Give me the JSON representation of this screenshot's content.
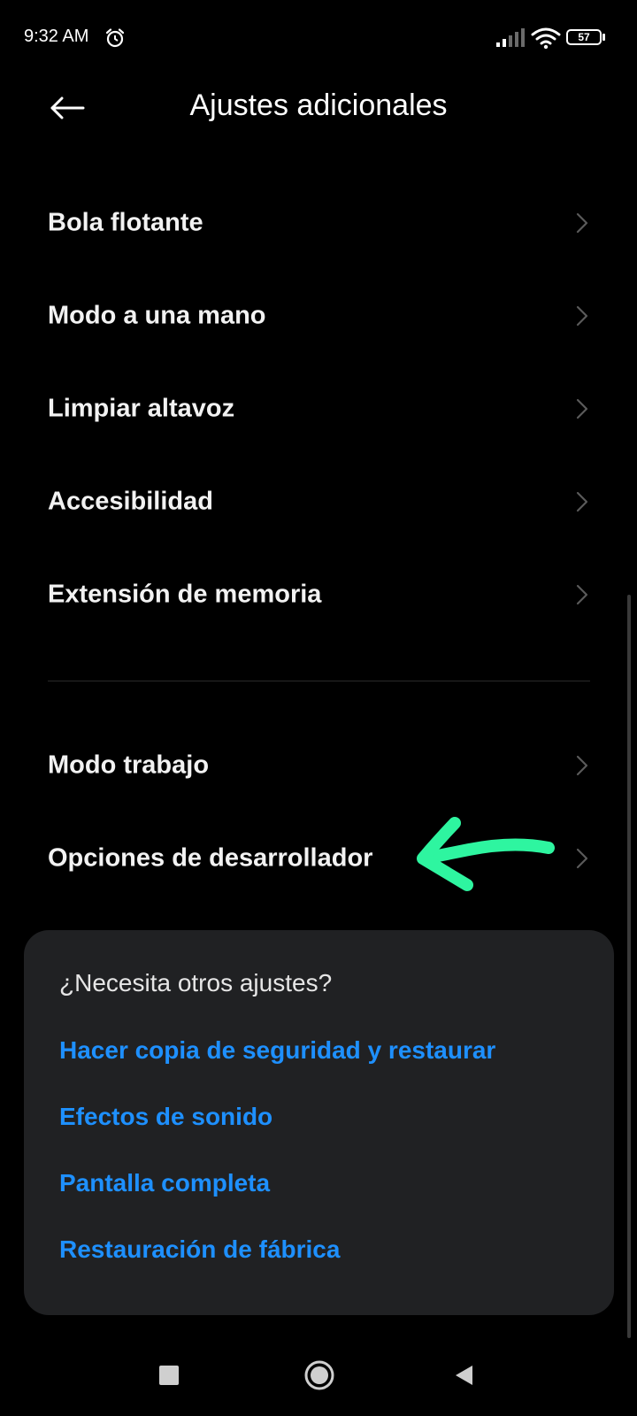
{
  "status_bar": {
    "time": "9:32 AM",
    "battery_level": "57",
    "battery_fraction": 0.57
  },
  "header": {
    "back_icon": "arrow-left-icon",
    "title": "Ajustes adicionales"
  },
  "settings": {
    "group1": [
      {
        "label": "Bola flotante"
      },
      {
        "label": "Modo a una mano"
      },
      {
        "label": "Limpiar altavoz"
      },
      {
        "label": "Accesibilidad"
      },
      {
        "label": "Extensión de memoria"
      }
    ],
    "group2": [
      {
        "label": "Modo trabajo"
      },
      {
        "label": "Opciones de desarrollador"
      }
    ]
  },
  "annotation": {
    "color": "#2ef5a0",
    "icon": "hand-drawn-arrow-icon"
  },
  "suggestions": {
    "title": "¿Necesita otros ajustes?",
    "links": [
      {
        "label": "Hacer copia de seguridad y restaurar"
      },
      {
        "label": "Efectos de sonido"
      },
      {
        "label": "Pantalla completa"
      },
      {
        "label": "Restauración de fábrica"
      }
    ],
    "link_color": "#1e90ff"
  },
  "nav_bar": {
    "recents_icon": "square-icon",
    "home_icon": "circle-icon",
    "back_icon": "triangle-back-icon"
  }
}
